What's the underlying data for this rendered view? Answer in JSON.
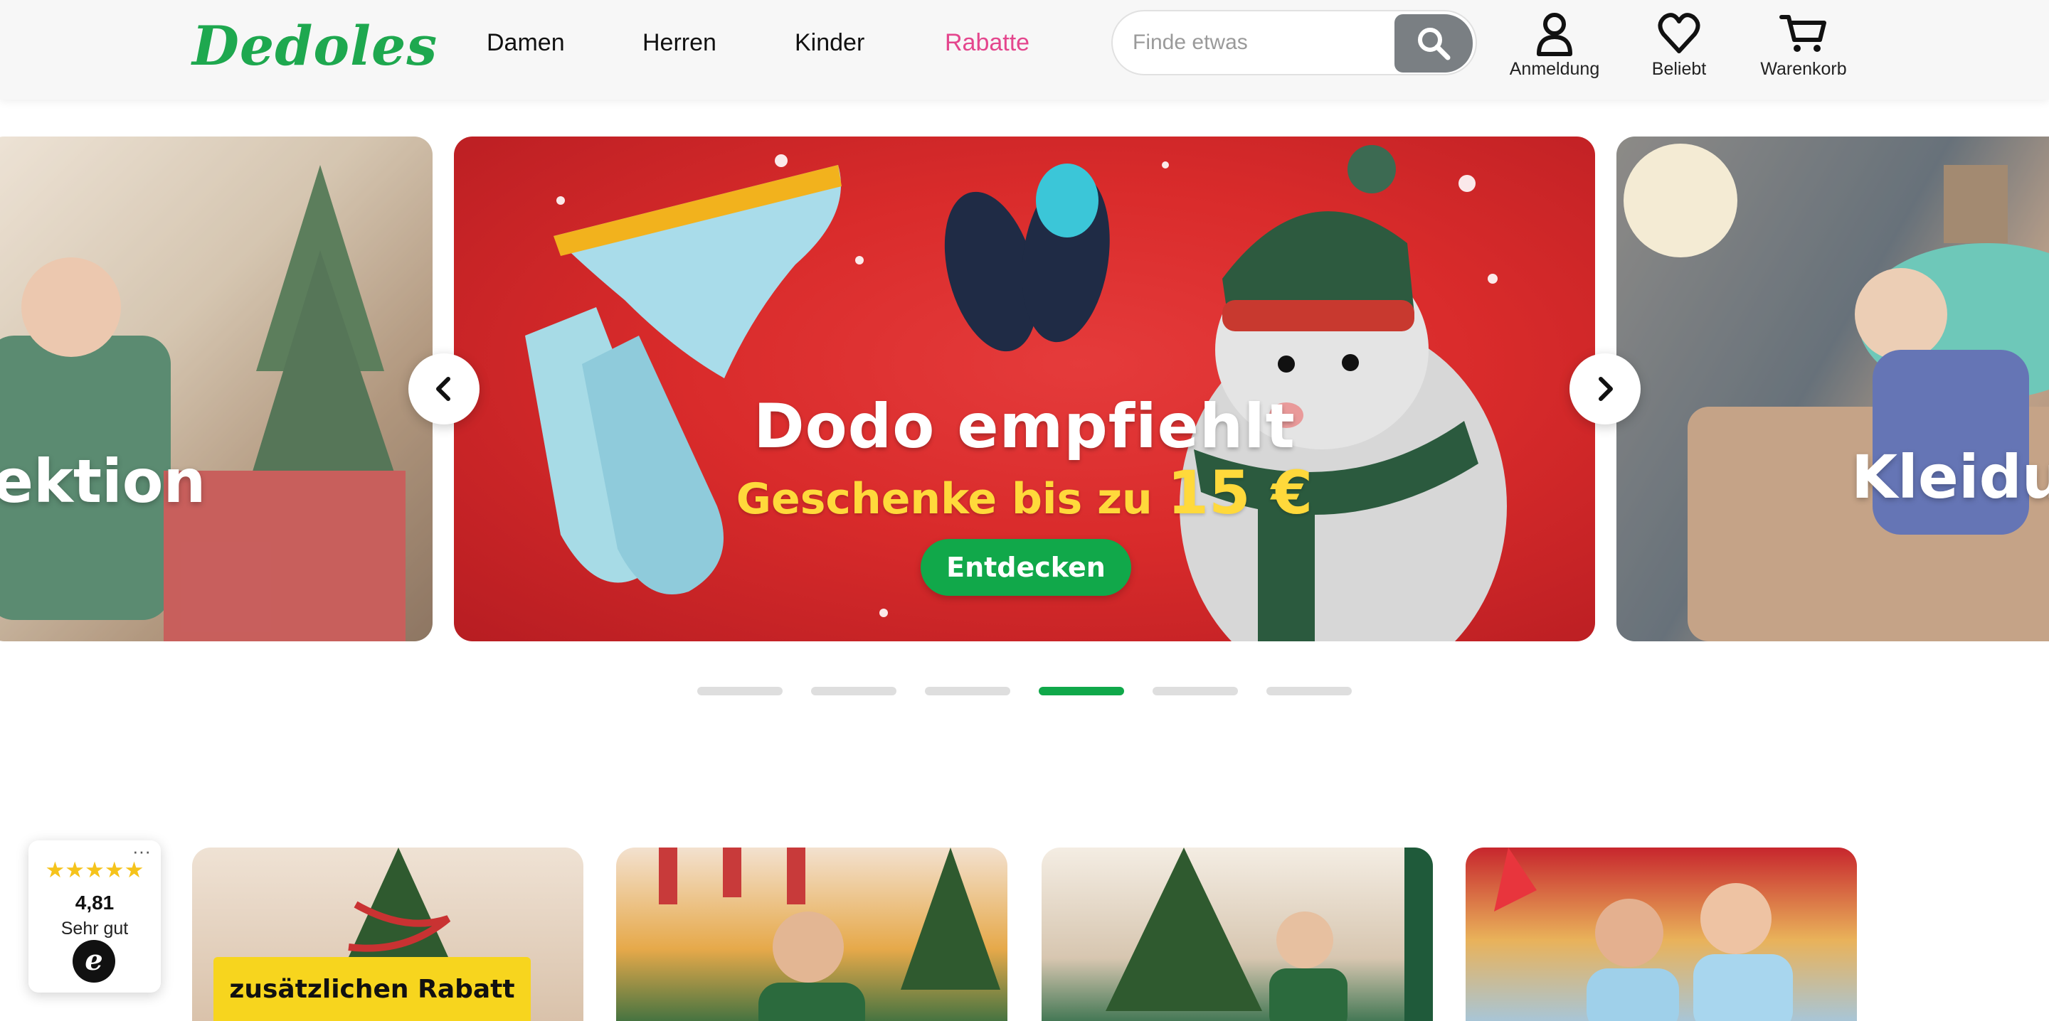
{
  "brand": {
    "logo_text": "Dedoles"
  },
  "nav": {
    "items": [
      {
        "label": "Damen"
      },
      {
        "label": "Herren"
      },
      {
        "label": "Kinder"
      },
      {
        "label": "Rabatte",
        "color": "#e4468d"
      }
    ]
  },
  "search": {
    "placeholder": "Finde etwas",
    "value": ""
  },
  "header_actions": {
    "account": {
      "label": "Anmeldung",
      "icon": "user-icon"
    },
    "favorites": {
      "label": "Beliebt",
      "icon": "heart-icon"
    },
    "cart": {
      "label": "Warenkorb",
      "icon": "cart-icon"
    }
  },
  "carousel": {
    "prev_slide_text": "ektion",
    "main_slide": {
      "headline": "Dodo empfiehlt",
      "sub_prefix": "Geschenke bis zu",
      "sub_amount": "15 €",
      "cta": "Entdecken"
    },
    "next_slide_text": "Kleidu",
    "slide_count": 6,
    "active_index": 3
  },
  "cards": {
    "first_promo": "zusätzlichen Rabatt"
  },
  "rating_widget": {
    "menu": "···",
    "stars": "★★★★★",
    "score": "4,81",
    "verdict": "Sehr gut",
    "seal_letter": "e"
  },
  "colors": {
    "brand_green": "#1ea84f",
    "sale_pink": "#e4468d",
    "banner_red": "#d92b2b",
    "promo_yellow": "#f7d51e"
  }
}
